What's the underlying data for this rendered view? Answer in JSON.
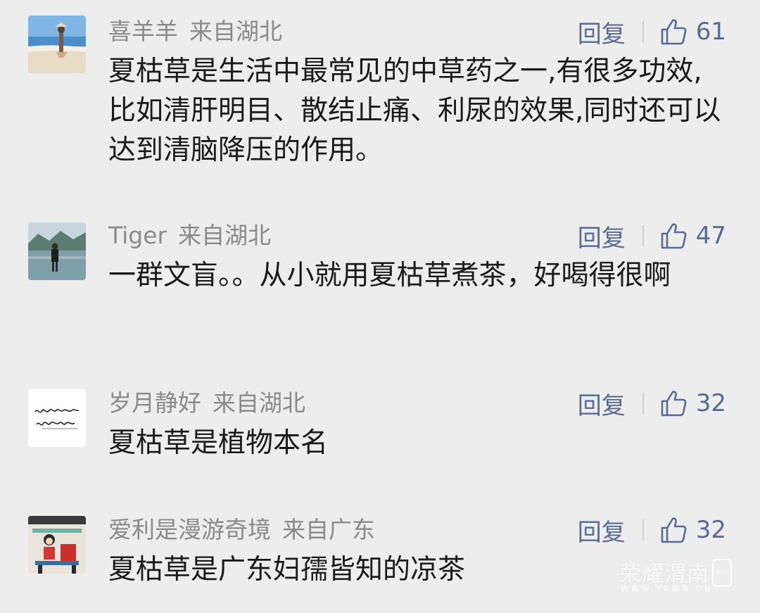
{
  "comments": [
    {
      "username": "喜羊羊",
      "location": "来自湖北",
      "reply_label": "回复",
      "like_count": "61",
      "text": "夏枯草是生活中最常见的中草药之一,有很多功效,比如清肝明目、散结止痛、利尿的效果,同时还可以达到清脑降压的作用。",
      "avatar": "beach-photo"
    },
    {
      "username": "Tiger",
      "location": "来自湖北",
      "reply_label": "回复",
      "like_count": "47",
      "text": "一群文盲。。从小就用夏枯草煮茶，好喝得很啊",
      "avatar": "lake-portrait-photo"
    },
    {
      "username": "岁月静好",
      "location": "来自湖北",
      "reply_label": "回复",
      "like_count": "32",
      "text": "夏枯草是植物本名",
      "avatar": "handwriting-image"
    },
    {
      "username": "爱利是漫游奇境",
      "location": "来自广东",
      "reply_label": "回复",
      "like_count": "32",
      "text": "夏枯草是广东妇孺皆知的凉茶",
      "avatar": "cartoon-girl-image"
    }
  ],
  "watermark": {
    "main": "荣耀渭南",
    "sub": "WWW.YEWN.CN",
    "badge": "APP"
  },
  "colors": {
    "background": "#ededed",
    "action_blue": "#576b95",
    "meta_gray": "#8a8a8a",
    "text": "#1a1a1a"
  }
}
